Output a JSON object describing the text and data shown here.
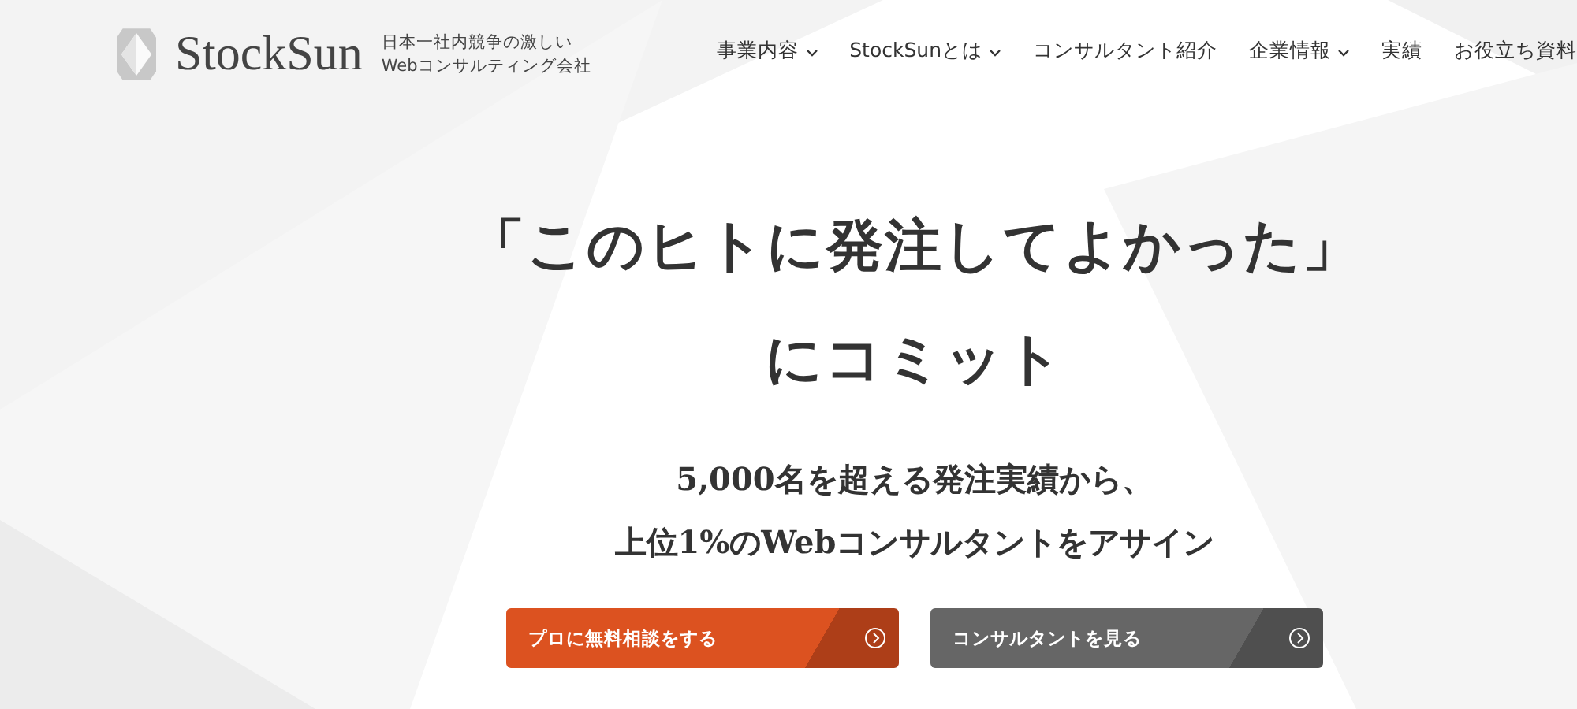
{
  "logo": {
    "name": "StockSun",
    "tagline": [
      "日本一社内競争の激しい",
      "Webコンサルティング会社"
    ]
  },
  "nav": [
    {
      "label": "事業内容",
      "dropdown": true
    },
    {
      "label": "StockSunとは",
      "dropdown": true
    },
    {
      "label": "コンサルタント紹介",
      "dropdown": false
    },
    {
      "label": "企業情報",
      "dropdown": true
    },
    {
      "label": "実績",
      "dropdown": false
    },
    {
      "label": "お役立ち資料",
      "dropdown": false
    }
  ],
  "headline": [
    "「このヒトに発注してよかった」",
    "にコミット"
  ],
  "subheadline": [
    "5,000名を超える発注実績から、",
    "上位1%のWebコンサルタントをアサイン"
  ],
  "buttons": [
    {
      "label": "プロに無料相談をする",
      "kind": "primary"
    },
    {
      "label": "コンサルタントを見る",
      "kind": "secondary"
    }
  ]
}
